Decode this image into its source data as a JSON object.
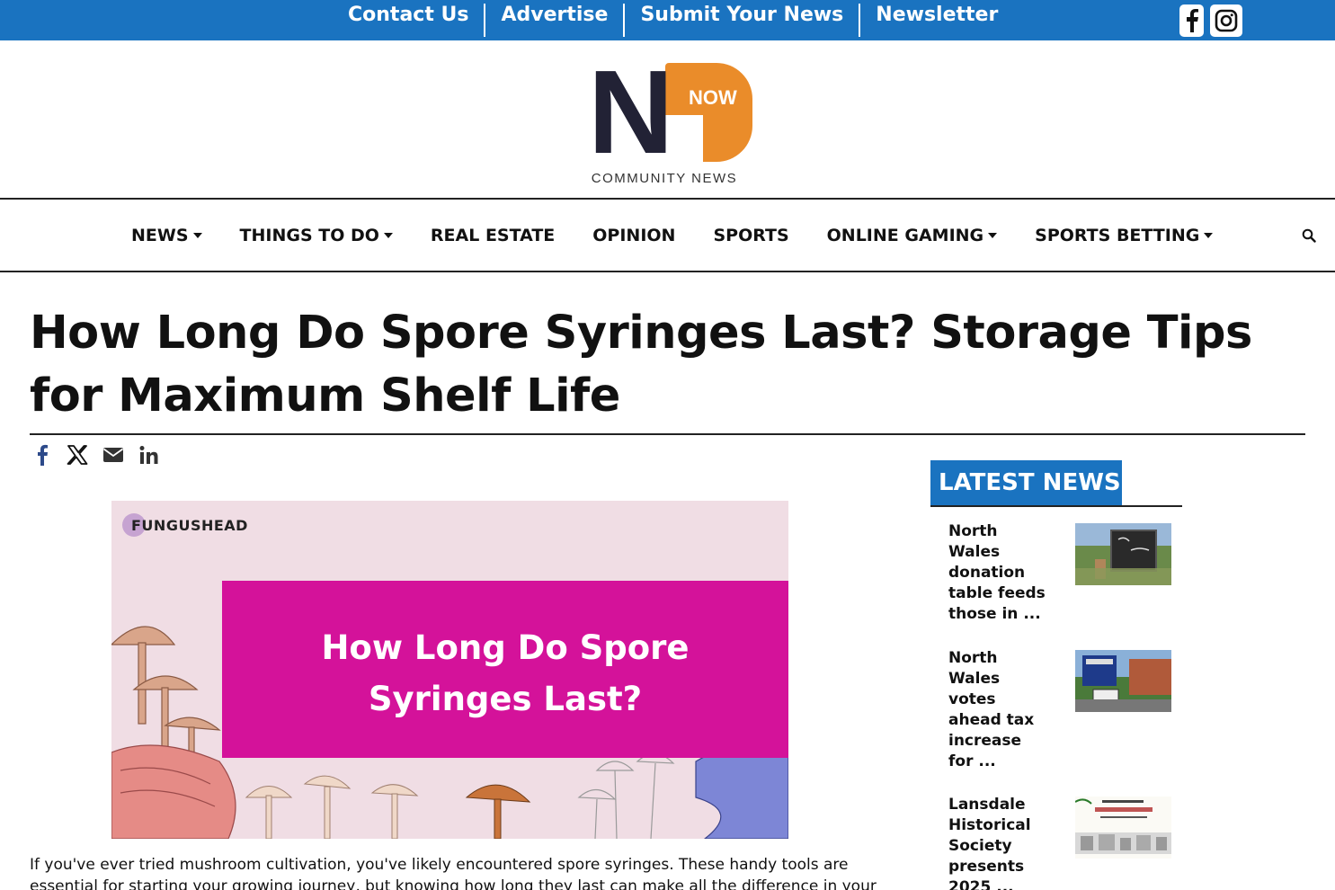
{
  "topbar": {
    "links": [
      "Contact Us",
      "Advertise",
      "Submit Your News",
      "Newsletter"
    ],
    "social": [
      "facebook-icon",
      "instagram-icon"
    ],
    "color": "#1a73c0"
  },
  "logo": {
    "letters": "NP",
    "badge": "NOW",
    "subtitle": "COMMUNITY NEWS",
    "colors": {
      "dark": "#222235",
      "orange": "#ea8c2a"
    }
  },
  "nav": {
    "items": [
      {
        "label": "NEWS",
        "dropdown": true
      },
      {
        "label": "THINGS TO DO",
        "dropdown": true
      },
      {
        "label": "REAL ESTATE",
        "dropdown": false
      },
      {
        "label": "OPINION",
        "dropdown": false
      },
      {
        "label": "SPORTS",
        "dropdown": false
      },
      {
        "label": "ONLINE GAMING",
        "dropdown": true
      },
      {
        "label": "SPORTS BETTING",
        "dropdown": true
      }
    ],
    "search_icon": "search-icon"
  },
  "article": {
    "title": "How Long Do Spore Syringes Last? Storage Tips for Maximum Shelf Life",
    "share": [
      "facebook-icon",
      "x-icon",
      "email-icon",
      "linkedin-icon"
    ],
    "hero": {
      "brand": "FUNGUSHEAD",
      "line1": "How Long Do Spore",
      "line2": "Syringes Last?",
      "banner_color": "#d4129a"
    },
    "intro": "If you've ever tried mushroom cultivation, you've likely encountered spore syringes. These handy tools are essential for starting your growing journey, but knowing how long they last can make all the difference in your success."
  },
  "sidebar": {
    "heading": "LATEST NEWS",
    "items": [
      {
        "title": "North Wales donation table feeds those in ..."
      },
      {
        "title": "North Wales votes ahead tax increase for ..."
      },
      {
        "title": "Lansdale Historical Society presents 2025 ..."
      }
    ]
  }
}
